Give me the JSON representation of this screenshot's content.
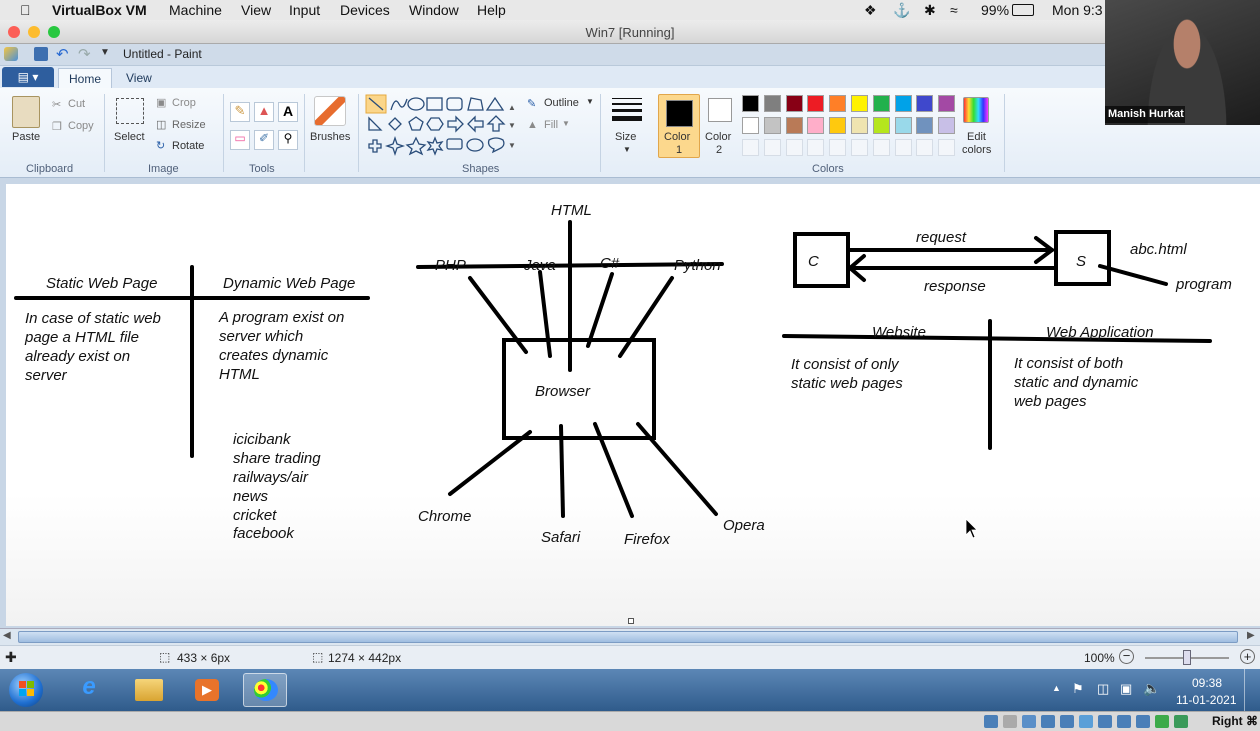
{
  "mac_menu": {
    "app": "VirtualBox VM",
    "items": [
      "Machine",
      "View",
      "Input",
      "Devices",
      "Window",
      "Help"
    ],
    "battery": "99%",
    "clock": "Mon 9:3"
  },
  "vm_window": {
    "title": "Win7 [Running]"
  },
  "paint": {
    "doc_title": "Untitled - Paint",
    "tabs": {
      "file": "▤ ▾",
      "home": "Home",
      "view": "View"
    },
    "clipboard": {
      "paste": "Paste",
      "cut": "Cut",
      "copy": "Copy",
      "label": "Clipboard"
    },
    "image": {
      "select": "Select",
      "crop": "Crop",
      "resize": "Resize",
      "rotate": "Rotate",
      "label": "Image"
    },
    "tools": {
      "label": "Tools"
    },
    "brushes": "Brushes",
    "shapes": {
      "outline": "Outline",
      "fill": "Fill",
      "label": "Shapes"
    },
    "size": "Size",
    "color1": {
      "line1": "Color",
      "line2": "1"
    },
    "color2": {
      "line1": "Color",
      "line2": "2"
    },
    "edit_colors": {
      "line1": "Edit",
      "line2": "colors"
    },
    "colors_label": "Colors",
    "palette_row1": [
      "#000000",
      "#7f7f7f",
      "#880015",
      "#ed1c24",
      "#ff7f27",
      "#fff200",
      "#22b14c",
      "#00a2e8",
      "#3f48cc",
      "#a349a4"
    ],
    "palette_row2": [
      "#ffffff",
      "#c3c3c3",
      "#b97a57",
      "#ffaec9",
      "#ffc90e",
      "#efe4b0",
      "#b5e61d",
      "#99d9ea",
      "#7092be",
      "#c8bfe7"
    ]
  },
  "drawing": {
    "section1": {
      "header_left": "Static Web Page",
      "header_right": "Dynamic Web Page",
      "left_text": [
        "In case of static web",
        "page a HTML file",
        "already exist on",
        "server"
      ],
      "right_text": [
        "A program exist on",
        "server which",
        "creates dynamic",
        "HTML"
      ],
      "examples": [
        "icicibank",
        "share trading",
        "railways/air",
        "news",
        "cricket",
        "facebook"
      ]
    },
    "section2": {
      "top": "HTML",
      "langs": [
        "PHP",
        "Java",
        "C#",
        "Python"
      ],
      "center": "Browser",
      "browsers": [
        "Chrome",
        "Safari",
        "Firefox",
        "Opera"
      ]
    },
    "section3": {
      "client": "C",
      "server": "S",
      "request": "request",
      "response": "response",
      "file": "abc.html",
      "program": "program",
      "col_left": "Website",
      "col_right": "Web Application",
      "left_text": [
        "It consist of only",
        "static web pages"
      ],
      "right_text": [
        "It consist of both",
        "static and dynamic",
        "web pages"
      ]
    }
  },
  "status_bar": {
    "selection": "433 × 6px",
    "canvas_size": "1274 × 442px",
    "zoom": "100%"
  },
  "taskbar": {
    "time": "09:38",
    "date": "11-01-2021"
  },
  "vbox_status": {
    "host_key": "Right ⌘"
  },
  "webcam": {
    "name": "Manish Hurkat"
  }
}
